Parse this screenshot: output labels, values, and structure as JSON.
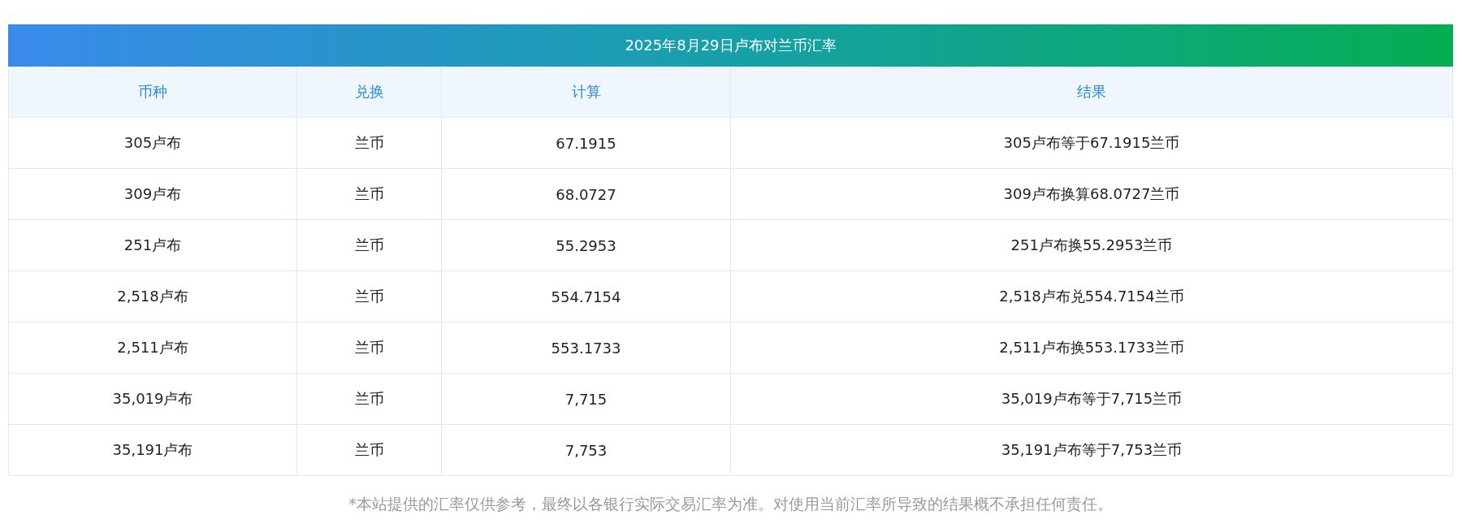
{
  "table": {
    "title": "2025年8月29日卢布对兰币汇率",
    "columns": [
      "币种",
      "兑换",
      "计算",
      "结果"
    ],
    "rows": [
      [
        "305卢布",
        "兰币",
        "67.1915",
        "305卢布等于67.1915兰币"
      ],
      [
        "309卢布",
        "兰币",
        "68.0727",
        "309卢布换算68.0727兰币"
      ],
      [
        "251卢布",
        "兰币",
        "55.2953",
        "251卢布换55.2953兰币"
      ],
      [
        "2,518卢布",
        "兰币",
        "554.7154",
        "2,518卢布兑554.7154兰币"
      ],
      [
        "2,511卢布",
        "兰币",
        "553.1733",
        "2,511卢布换553.1733兰币"
      ],
      [
        "35,019卢布",
        "兰币",
        "7,715",
        "35,019卢布等于7,715兰币"
      ],
      [
        "35,191卢布",
        "兰币",
        "7,753",
        "35,191卢布等于7,753兰币"
      ]
    ]
  },
  "disclaimer": "*本站提供的汇率仅供参考，最终以各银行实际交易汇率为准。对使用当前汇率所导致的结果概不承担任何责任。"
}
